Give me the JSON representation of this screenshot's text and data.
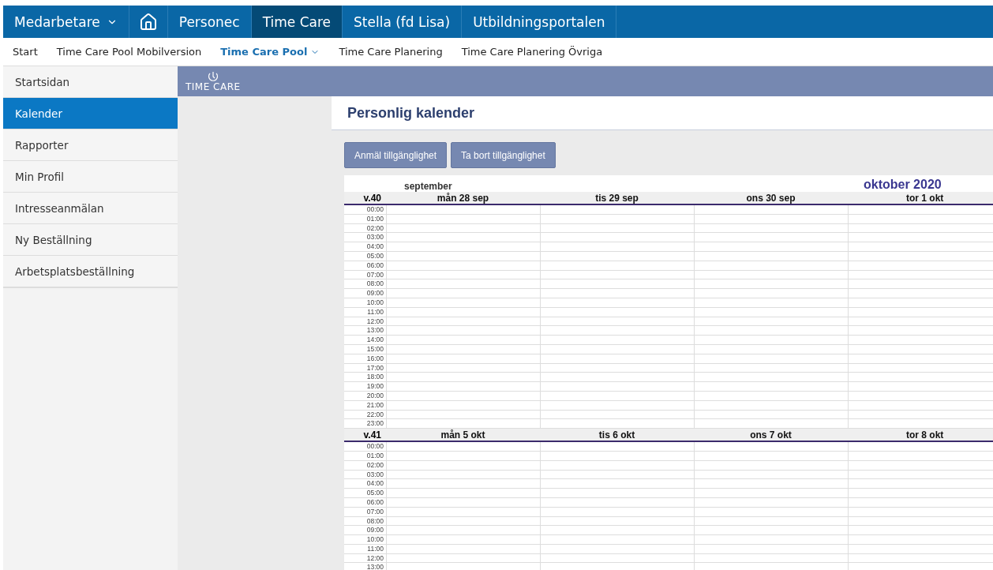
{
  "top_nav": [
    {
      "label": "Medarbetare",
      "kind": "dropdown",
      "selected": false
    },
    {
      "kind": "home",
      "selected": false
    },
    {
      "label": "Personec",
      "kind": "link",
      "selected": false
    },
    {
      "label": "Time Care",
      "kind": "link",
      "selected": true
    },
    {
      "label": "Stella (fd Lisa)",
      "kind": "link",
      "selected": false
    },
    {
      "label": "Utbildningsportalen",
      "kind": "link",
      "selected": false
    }
  ],
  "sub_nav": [
    {
      "label": "Start",
      "selected": false,
      "dropdown": false
    },
    {
      "label": "Time Care Pool Mobilversion",
      "selected": false,
      "dropdown": false
    },
    {
      "label": "Time Care Pool",
      "selected": true,
      "dropdown": true
    },
    {
      "label": "Time Care Planering",
      "selected": false,
      "dropdown": false
    },
    {
      "label": "Time Care Planering Övriga",
      "selected": false,
      "dropdown": false
    }
  ],
  "sidebar": {
    "items": [
      {
        "label": "Startsidan",
        "selected": false
      },
      {
        "label": "Kalender",
        "selected": true
      },
      {
        "label": "Rapporter",
        "selected": false
      },
      {
        "label": "Min Profil",
        "selected": false
      },
      {
        "label": "Intresseanmälan",
        "selected": false
      },
      {
        "label": "Ny Beställning",
        "selected": false
      },
      {
        "label": "Arbetsplatsbeställning",
        "selected": false
      }
    ]
  },
  "banner": {
    "logo_text": "TIME CARE"
  },
  "page_title": "Personlig kalender",
  "buttons": [
    "Anmäl tillgänglighet",
    "Ta bort tillgänglighet"
  ],
  "calendar": {
    "month_left": "september",
    "month_right": "oktober 2020",
    "weeks": [
      {
        "label": "v.40",
        "days": [
          "mån 28 sep",
          "tis 29 sep",
          "ons 30 sep",
          "tor 1 okt"
        ],
        "hours": [
          "00:00",
          "01:00",
          "02:00",
          "03:00",
          "04:00",
          "05:00",
          "06:00",
          "07:00",
          "08:00",
          "09:00",
          "10:00",
          "11:00",
          "12:00",
          "13:00",
          "14:00",
          "15:00",
          "16:00",
          "17:00",
          "18:00",
          "19:00",
          "20:00",
          "21:00",
          "22:00",
          "23:00"
        ]
      },
      {
        "label": "v.41",
        "days": [
          "mån 5 okt",
          "tis 6 okt",
          "ons 7 okt",
          "tor 8 okt"
        ],
        "hours": [
          "00:00",
          "01:00",
          "02:00",
          "03:00",
          "04:00",
          "05:00",
          "06:00",
          "07:00",
          "08:00",
          "09:00",
          "10:00",
          "11:00",
          "12:00",
          "13:00"
        ]
      }
    ]
  }
}
